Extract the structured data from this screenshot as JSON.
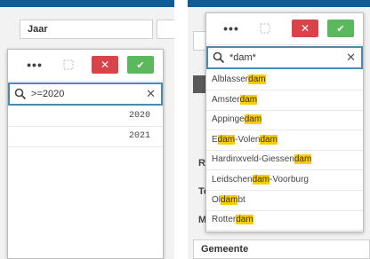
{
  "left_panel": {
    "field_title": "Jaar",
    "toolbar": {
      "more_label": "•••",
      "clear_label": "✕",
      "confirm_label": "✔"
    },
    "search": {
      "value": ">=2020",
      "clear_label": "✕"
    },
    "results": [
      "2020",
      "2021"
    ]
  },
  "right_panel": {
    "toolbar": {
      "more_label": "•••",
      "clear_label": "✕",
      "confirm_label": "✔"
    },
    "search": {
      "value": "*dam*",
      "clear_label": "✕"
    },
    "results": [
      {
        "pre": "Alblasser",
        "hit": "dam",
        "post": ""
      },
      {
        "pre": "Amster",
        "hit": "dam",
        "post": ""
      },
      {
        "pre": "Appinge",
        "hit": "dam",
        "post": ""
      },
      {
        "pre": "E",
        "hit": "dam",
        "post": "-Volen",
        "hit2": "dam"
      },
      {
        "pre": "Hardinxveld-Giessen",
        "hit": "dam",
        "post": ""
      },
      {
        "pre": "Leidschen",
        "hit": "dam",
        "post": "-Voorburg"
      },
      {
        "pre": "Ol",
        "hit": "dam",
        "post": "bt"
      },
      {
        "pre": "Rotter",
        "hit": "dam",
        "post": ""
      }
    ],
    "side_labels": [
      "Re",
      "Te",
      "M"
    ],
    "bottom_field": "Gemeente"
  },
  "colors": {
    "clear": "#d9444a",
    "confirm": "#5cb85c",
    "highlight": "#ffcc00",
    "focus": "#4b8ab3",
    "blue_bar": "#0e5d96"
  }
}
